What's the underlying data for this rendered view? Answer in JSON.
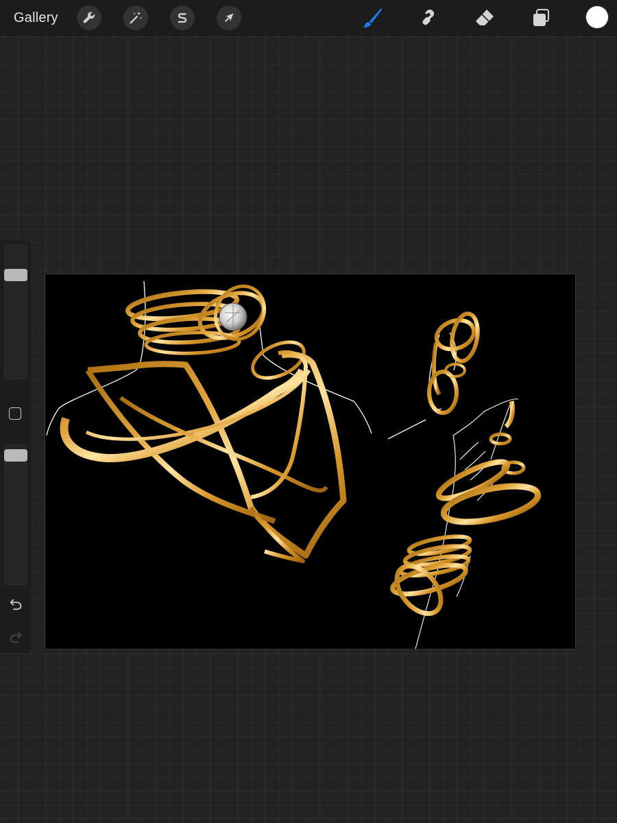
{
  "toolbar": {
    "gallery_label": "Gallery",
    "left_tools": [
      {
        "name": "actions",
        "icon": "wrench-icon"
      },
      {
        "name": "adjustments",
        "icon": "magic-wand-icon"
      },
      {
        "name": "selection",
        "icon": "selection-s-icon"
      },
      {
        "name": "transform",
        "icon": "arrow-cursor-icon"
      }
    ],
    "right_tools": [
      {
        "name": "brush",
        "icon": "brush-icon",
        "active": true
      },
      {
        "name": "smudge",
        "icon": "smudge-icon"
      },
      {
        "name": "eraser",
        "icon": "eraser-icon"
      },
      {
        "name": "layers",
        "icon": "layers-icon"
      }
    ],
    "current_color": "#ffffff",
    "active_color": "#1e7cf2"
  },
  "sidebar": {
    "brush_size_level": 0.2,
    "opacity_level": 0.04,
    "icons": [
      "modify-square-icon",
      "undo-icon",
      "redo-icon"
    ]
  },
  "canvas": {
    "background": "#000000",
    "artwork_colors": {
      "gold_dark": "#a86d10",
      "gold": "#e0a43a",
      "gold_light": "#ffe3a0",
      "line": "#ffffff"
    }
  }
}
